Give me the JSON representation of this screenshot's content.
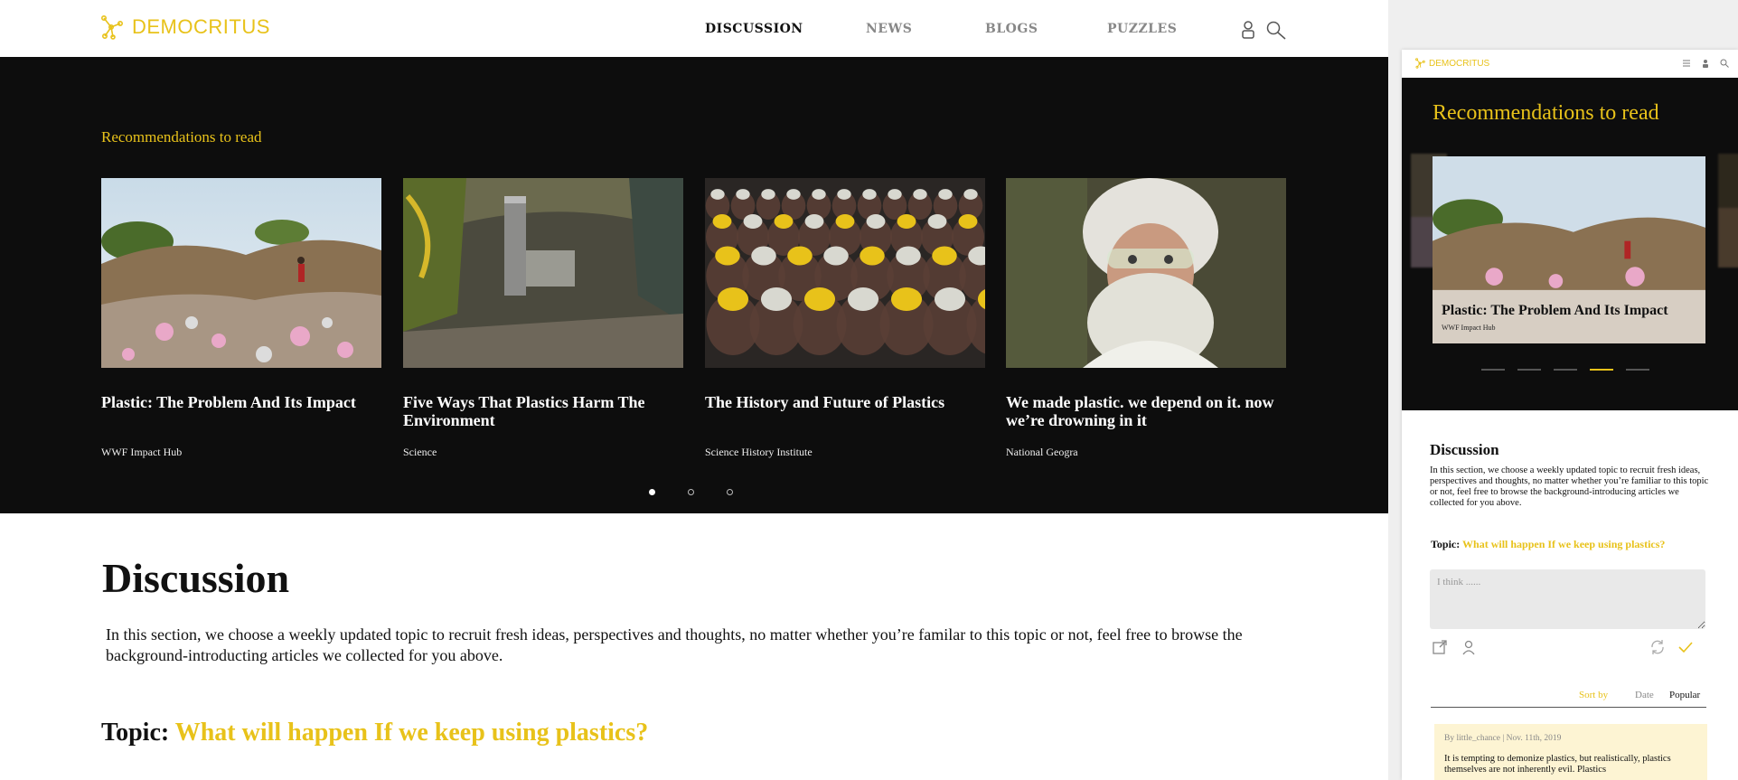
{
  "brand": {
    "name": "DEMOCRITUS",
    "accent": "#e8c21a",
    "bg_dark": "#0d0d0d"
  },
  "nav": {
    "items": [
      "DISCUSSION",
      "NEWS",
      "BLOGS",
      "PUZZLES"
    ],
    "active": "DISCUSSION",
    "icons": [
      "user-icon",
      "search-icon"
    ]
  },
  "hero": {
    "title": "Recommendations to read",
    "cards": [
      {
        "title": "Plastic: The Problem And Its Impact",
        "source": "WWF Impact Hub",
        "image": "landfill-photo"
      },
      {
        "title": "Five Ways That Plastics Harm The Environment",
        "source": "Science",
        "image": "tunnel-photo"
      },
      {
        "title": "The History and Future of Plastics",
        "source": "Science History Institute",
        "image": "bottles-photo"
      },
      {
        "title": "We made plastic. we depend on it. now we’re drowning in it",
        "source": "National Geogra",
        "image": "worker-photo"
      }
    ],
    "pages": 3,
    "current_page": 1
  },
  "discussion": {
    "heading": "Discussion",
    "intro": "In this section, we choose a weekly updated topic to recruit fresh ideas, perspectives and thoughts, no matter whether you’re familar to this topic or not, feel free to browse the background-introducting articles we collected for you above.",
    "topic_label": "Topic:",
    "topic": "What will happen If we keep using plastics?"
  },
  "mobile": {
    "brand": "DEMOCRITUS",
    "rec_title": "Recommendations to read",
    "card": {
      "title": "Plastic: The Problem And Its Impact",
      "source": "WWF Impact Hub"
    },
    "pager_count": 5,
    "pager_active": 4,
    "heading": "Discussion",
    "intro": "In this section, we choose a weekly updated topic to recruit fresh ideas, perspectives and thoughts, no matter whether you’re familiar to this topic or not, feel free to browse the background-introducing articles we collected for you above.",
    "topic_label": "Topic:",
    "topic": "What will happen If we keep using plastics?",
    "input_placeholder": "I think ......",
    "sort": {
      "label": "Sort by",
      "options": [
        "Date",
        "Popular"
      ],
      "selected": "Popular"
    },
    "comment": {
      "meta": "By little_chance | Nov. 11th, 2019",
      "text": "It is tempting to demonize plastics, but realistically, plastics themselves are not inherently evil. Plastics"
    }
  }
}
